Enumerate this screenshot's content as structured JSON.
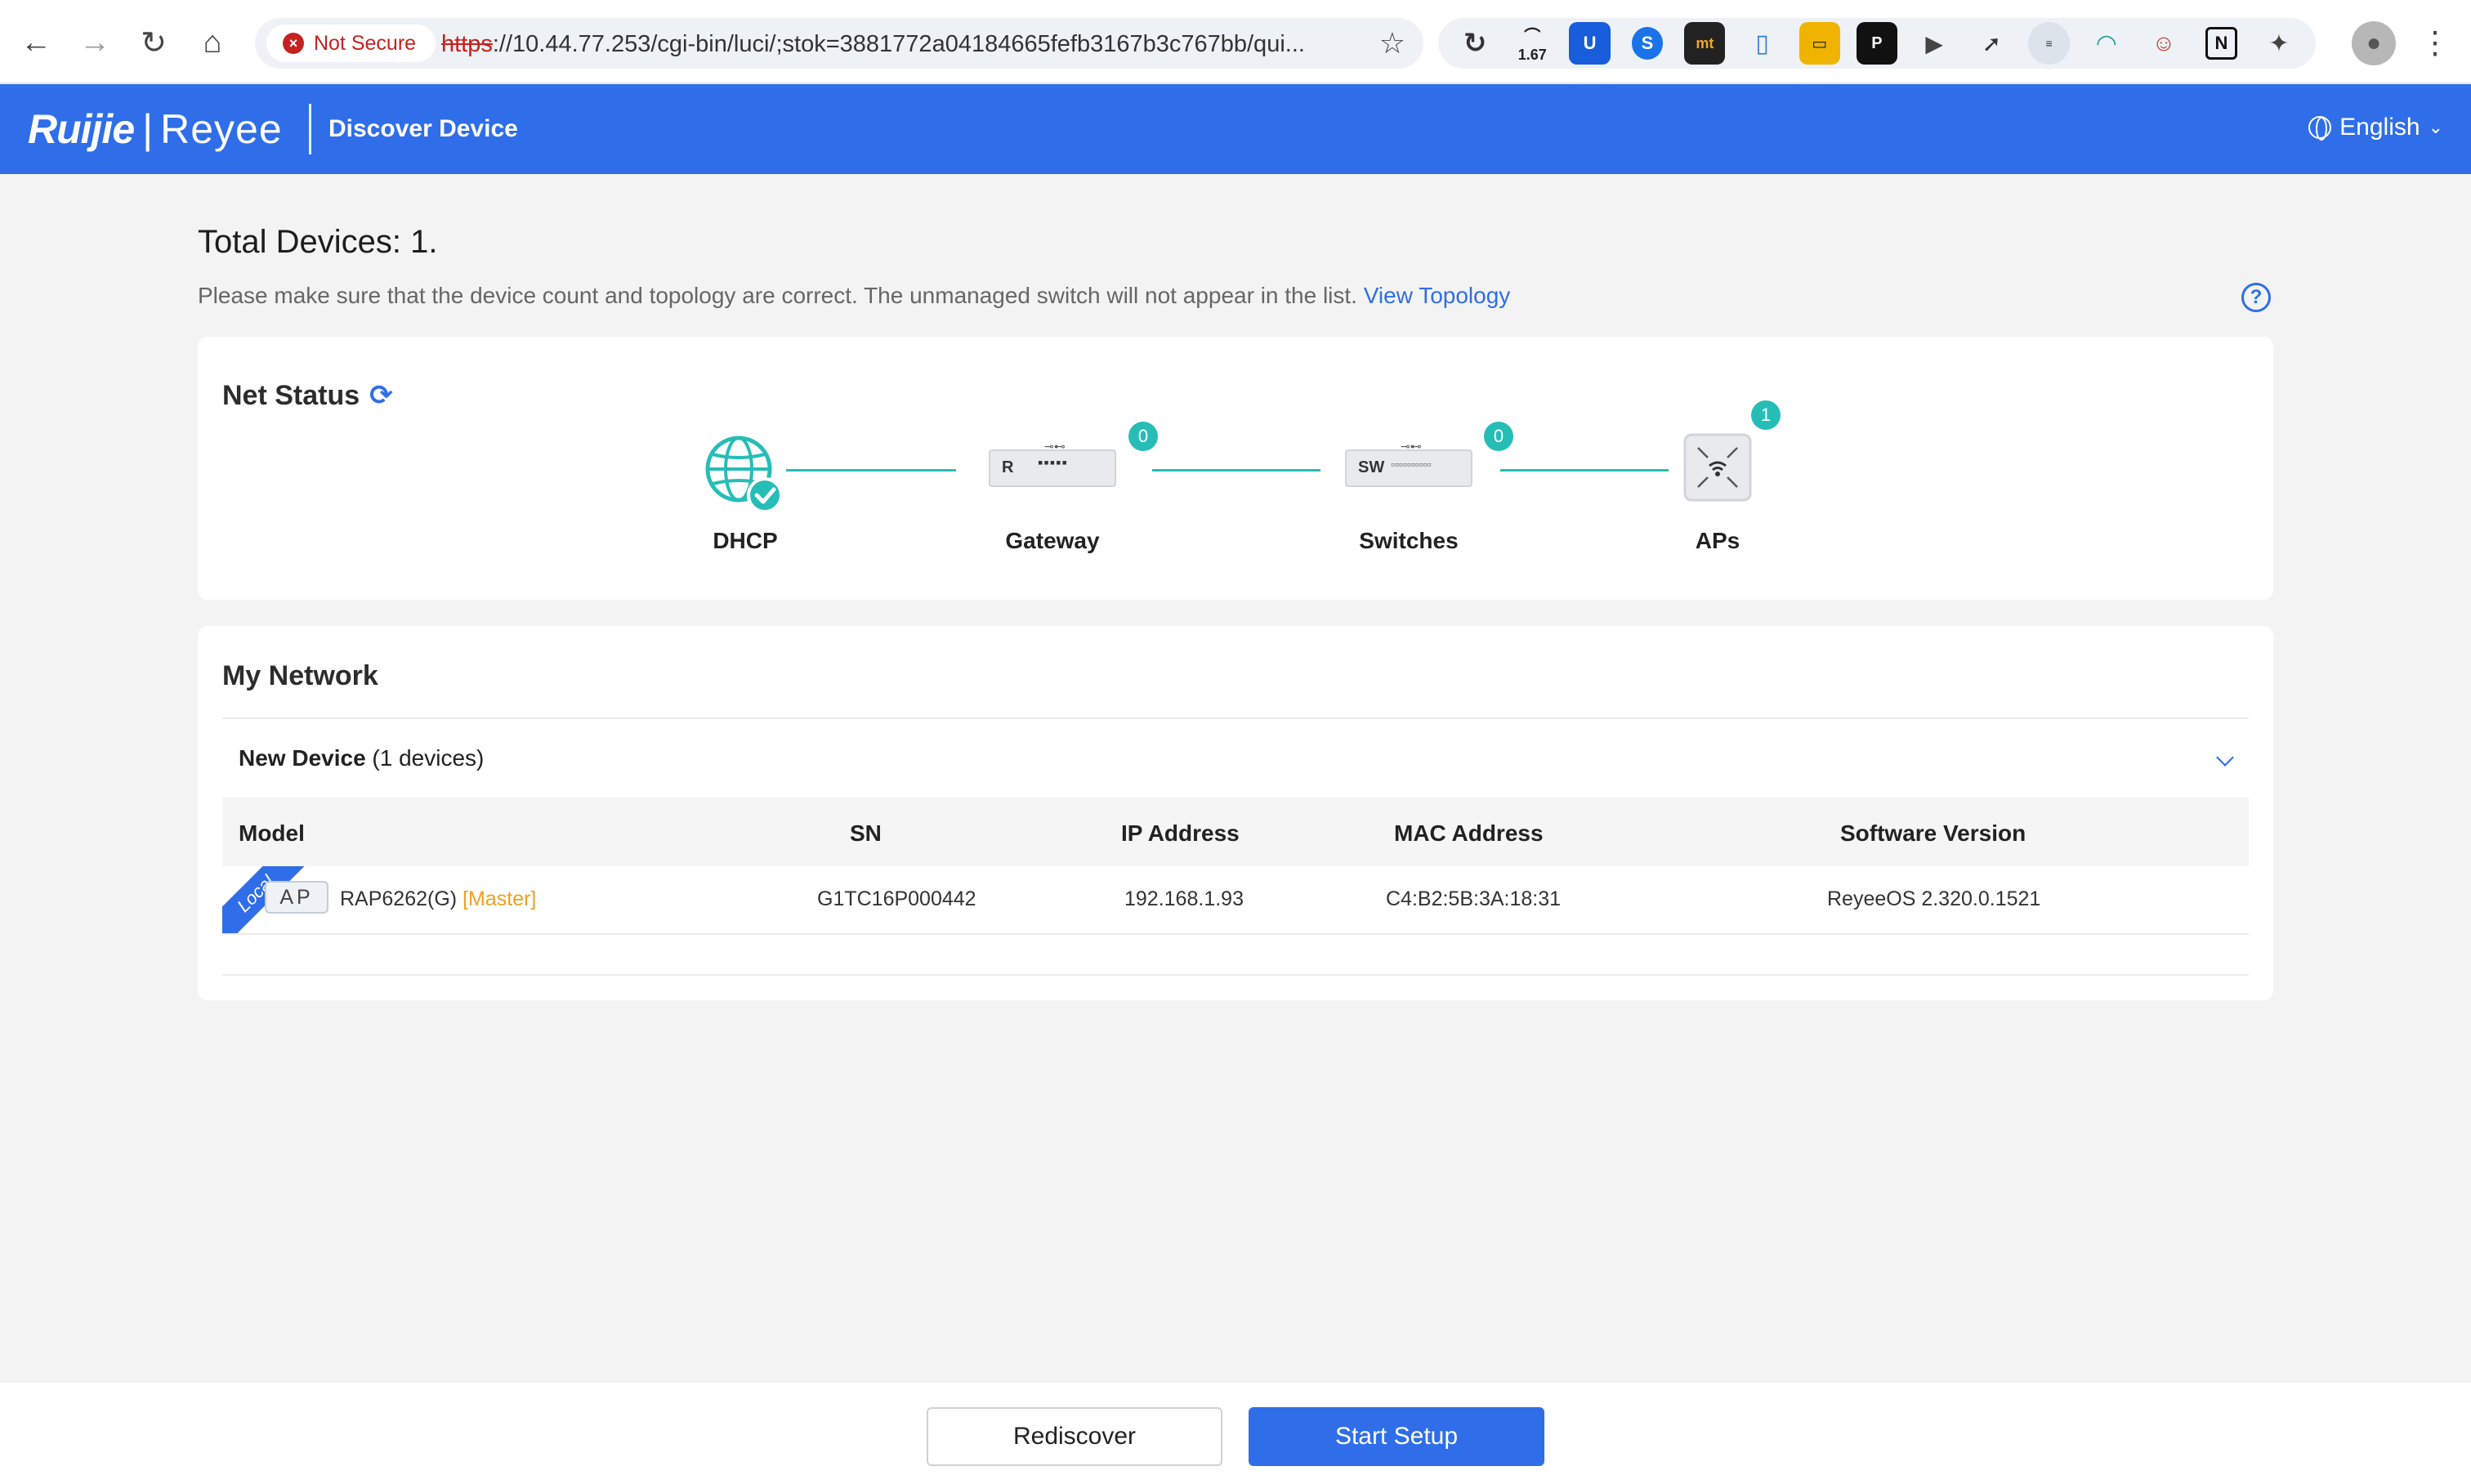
{
  "browser": {
    "security_label": "Not Secure",
    "url_scheme": "https",
    "url_rest": "://10.44.77.253/cgi-bin/luci/;stok=3881772a04184665fefb3167b3c767bb/qui...",
    "ext_counter": "1.67"
  },
  "header": {
    "logo_brand": "Ruijie",
    "logo_sub": "Reyee",
    "title": "Discover Device",
    "language": "English"
  },
  "summary": {
    "total_title": "Total Devices: 1.",
    "hint": "Please make sure that the device count and topology are correct. The unmanaged switch will not appear in the list.",
    "topology_link": "View Topology"
  },
  "net_status": {
    "title": "Net Status",
    "nodes": [
      {
        "label": "DHCP"
      },
      {
        "label": "Gateway",
        "count": "0",
        "device_tag": "R"
      },
      {
        "label": "Switches",
        "count": "0",
        "device_tag": "SW"
      },
      {
        "label": "APs",
        "count": "1"
      }
    ]
  },
  "my_network": {
    "title": "My Network",
    "group_label": "New Device",
    "group_count": "(1 devices)",
    "columns": [
      "Model",
      "SN",
      "IP Address",
      "MAC Address",
      "Software Version"
    ],
    "rows": [
      {
        "ribbon": "Local",
        "type_tag": "AP",
        "model": "RAP6262(G)",
        "role": "[Master]",
        "sn": "G1TC16P000442",
        "ip": "192.168.1.93",
        "mac": "C4:B2:5B:3A:18:31",
        "software": "ReyeeOS 2.320.0.1521"
      }
    ]
  },
  "footer": {
    "rediscover_label": "Rediscover",
    "start_label": "Start Setup"
  },
  "colors": {
    "brand_blue": "#2f6ee8",
    "status_teal": "#27bdb7",
    "master_orange": "#f0a020"
  }
}
